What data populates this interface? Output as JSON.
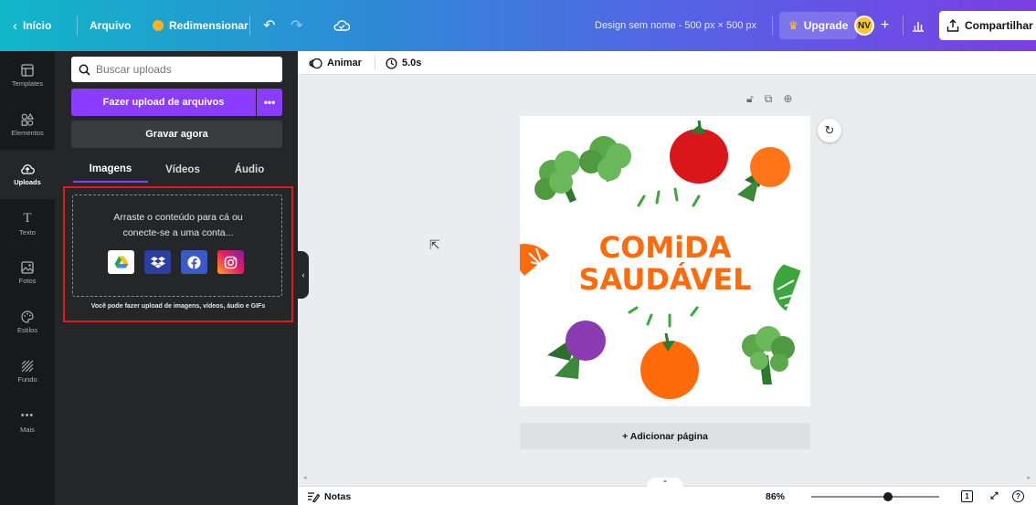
{
  "topbar": {
    "back_label": "Início",
    "file_label": "Arquivo",
    "resize_label": "Redimensionar",
    "design_name": "Design sem nome - 500 px × 500 px",
    "upgrade_label": "Upgrade",
    "avatar_initials": "NV",
    "share_label": "Compartilhar"
  },
  "rail": {
    "items": [
      {
        "label": "Templates",
        "icon": "templates-icon"
      },
      {
        "label": "Elementos",
        "icon": "elements-icon"
      },
      {
        "label": "Uploads",
        "icon": "upload-cloud-icon"
      },
      {
        "label": "Texto",
        "icon": "text-icon"
      },
      {
        "label": "Fotos",
        "icon": "photos-icon"
      },
      {
        "label": "Estilos",
        "icon": "styles-icon"
      },
      {
        "label": "Fundo",
        "icon": "background-icon"
      },
      {
        "label": "Mais",
        "icon": "more-icon"
      }
    ]
  },
  "panel": {
    "search_placeholder": "Buscar uploads",
    "upload_button": "Fazer upload de arquivos",
    "more_button": "•••",
    "record_button": "Gravar agora",
    "tabs": [
      "Imagens",
      "Vídeos",
      "Áudio"
    ],
    "dropzone_line1": "Arraste o conteúdo para cá ou",
    "dropzone_line2": "conecte-se a uma conta...",
    "dropzone_note": "Você pode fazer upload de imagens, vídeos, áudio e GIFs"
  },
  "editor": {
    "animate_label": "Animar",
    "duration_label": "5.0s",
    "add_page_label": "+ Adicionar página",
    "design_title_line1": "COMiDA",
    "design_title_line2": "SAUDÁVEL"
  },
  "bottombar": {
    "notes_label": "Notas",
    "zoom_value": "86%",
    "page_count": "1",
    "zoom_fraction": 0.6
  },
  "colors": {
    "accent": "#8b3dff",
    "highlight_frame": "#e0191c",
    "design_title": "#ff6b0a"
  }
}
